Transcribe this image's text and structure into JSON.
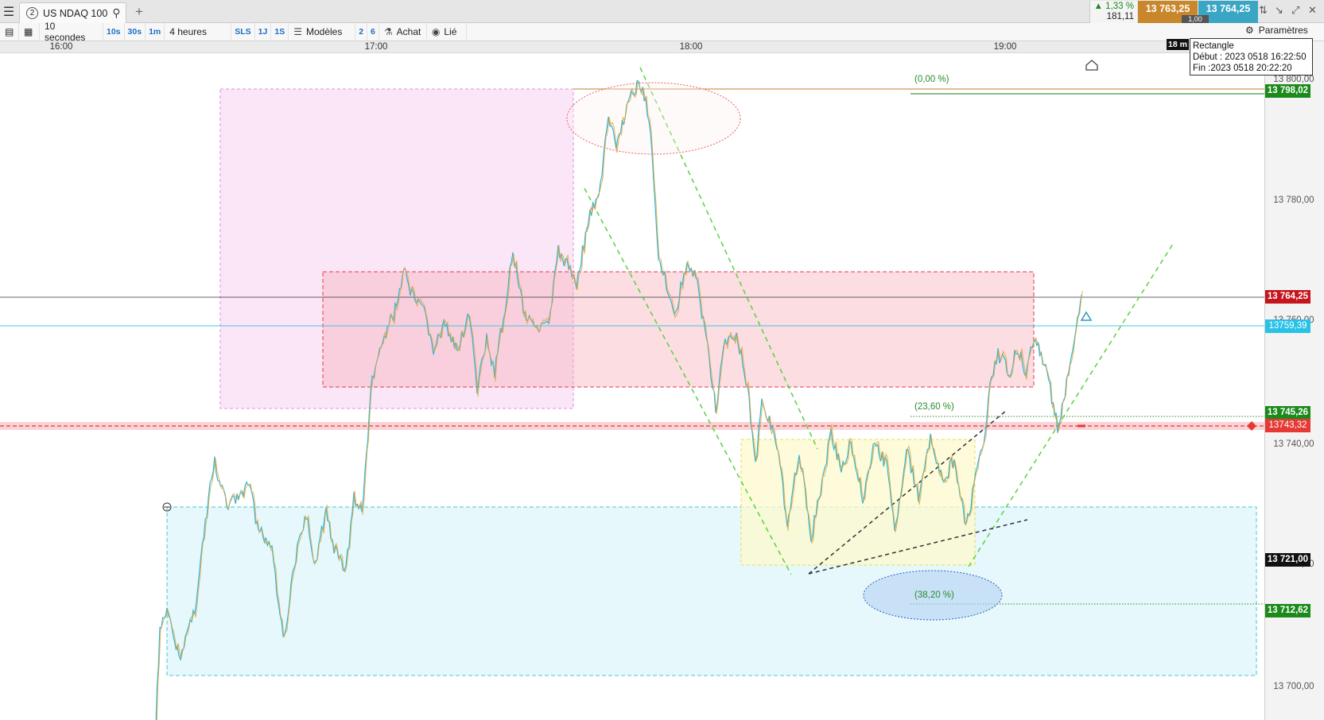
{
  "topbar": {
    "tab_number": "2",
    "instrument": "US NDAQ 100",
    "change_pct": "▲ 1,33 %",
    "change_pts": "181,11",
    "sell_price": "13 763,25",
    "buy_price": "13 764,25",
    "quantity": "1,00"
  },
  "toolbar": {
    "interval": "10 secondes",
    "quick_intervals": [
      "10s",
      "30s",
      "1m"
    ],
    "range": "4 heures",
    "sls": "SLS",
    "quick_ranges": [
      "1J",
      "1S"
    ],
    "models": "Modèles",
    "num_a": "2",
    "num_b": "6",
    "buy": "Achat",
    "linked": "Lié",
    "settings": "Paramètres"
  },
  "time_axis": {
    "labels": [
      "16:00",
      "17:00",
      "18:00",
      "19:00"
    ]
  },
  "timer": "18 m",
  "tooltip": {
    "title": "Rectangle",
    "start": "Début : 2023 0518 16:22:50",
    "end": "Fin :2023 0518 20:22:20"
  },
  "price_axis": {
    "labels": [
      "13 800,00",
      "13 780,00",
      "13 760,00",
      "13 740,00",
      "13 720,00",
      "13 700,00"
    ]
  },
  "price_tags": {
    "fib_0": "13 798,02",
    "current": "13 764,25",
    "cyan_line": "13759,39",
    "fib_236": "13 745,26",
    "red_line": "13743,32",
    "level_721": "13 721,00",
    "fib_382": "13 712,62"
  },
  "fib_labels": {
    "fib_0": "(0,00 %)",
    "fib_236": "(23,60 %)",
    "fib_382": "(38,20 %)"
  },
  "colors": {
    "sell": "#c8872a",
    "buy": "#3aa6c4",
    "price_up": "#2ab8d9",
    "price_down": "#e8a23a",
    "fib_green": "#2a8c2a",
    "red_level": "#e53935"
  }
}
